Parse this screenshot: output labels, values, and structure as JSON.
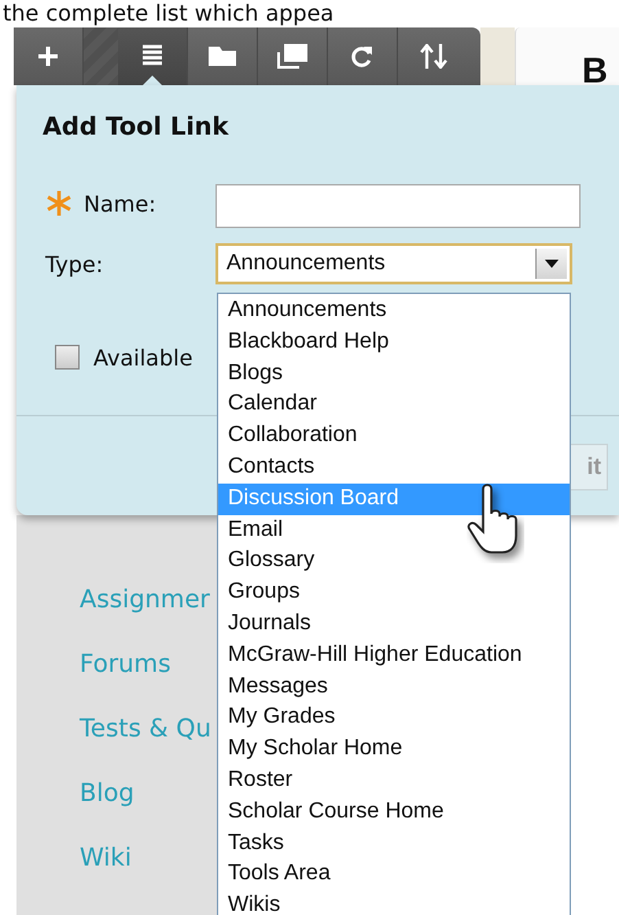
{
  "caption": "the complete list which appea",
  "toolbar": {
    "buttons": [
      {
        "kind": "plus",
        "selected": false
      },
      {
        "kind": "list",
        "selected": true
      },
      {
        "kind": "folder",
        "selected": false
      },
      {
        "kind": "windows",
        "selected": false
      },
      {
        "kind": "refresh",
        "selected": false
      },
      {
        "kind": "sort",
        "selected": false
      }
    ]
  },
  "page_heading": "B",
  "dialog": {
    "title": "Add Tool Link",
    "fields": [
      {
        "kind": "text",
        "label": "Name:",
        "required": true
      },
      {
        "kind": "select",
        "label": "Type:",
        "required": false,
        "value": "Announcements"
      }
    ],
    "checkbox": {
      "label": "Available",
      "checked": false
    },
    "submit_button": "it"
  },
  "dropdown": {
    "options": [
      {
        "label": "Announcements",
        "selected": false
      },
      {
        "label": "Blackboard Help",
        "selected": false
      },
      {
        "label": "Blogs",
        "selected": false
      },
      {
        "label": "Calendar",
        "selected": false
      },
      {
        "label": "Collaboration",
        "selected": false
      },
      {
        "label": "Contacts",
        "selected": false
      },
      {
        "label": "Discussion Board",
        "selected": true
      },
      {
        "label": "Email",
        "selected": false
      },
      {
        "label": "Glossary",
        "selected": false
      },
      {
        "label": "Groups",
        "selected": false
      },
      {
        "label": "Journals",
        "selected": false
      },
      {
        "label": "McGraw-Hill Higher Education",
        "selected": false
      },
      {
        "label": "Messages",
        "selected": false
      },
      {
        "label": "My Grades",
        "selected": false
      },
      {
        "label": "My Scholar Home",
        "selected": false
      },
      {
        "label": "Roster",
        "selected": false
      },
      {
        "label": "Scholar Course Home",
        "selected": false
      },
      {
        "label": "Tasks",
        "selected": false
      },
      {
        "label": "Tools Area",
        "selected": false
      },
      {
        "label": "Wikis",
        "selected": false
      }
    ]
  },
  "sidebar": {
    "links": [
      "Assignmer",
      "Forums",
      "Tests & Qu",
      "Blog",
      "Wiki"
    ]
  }
}
